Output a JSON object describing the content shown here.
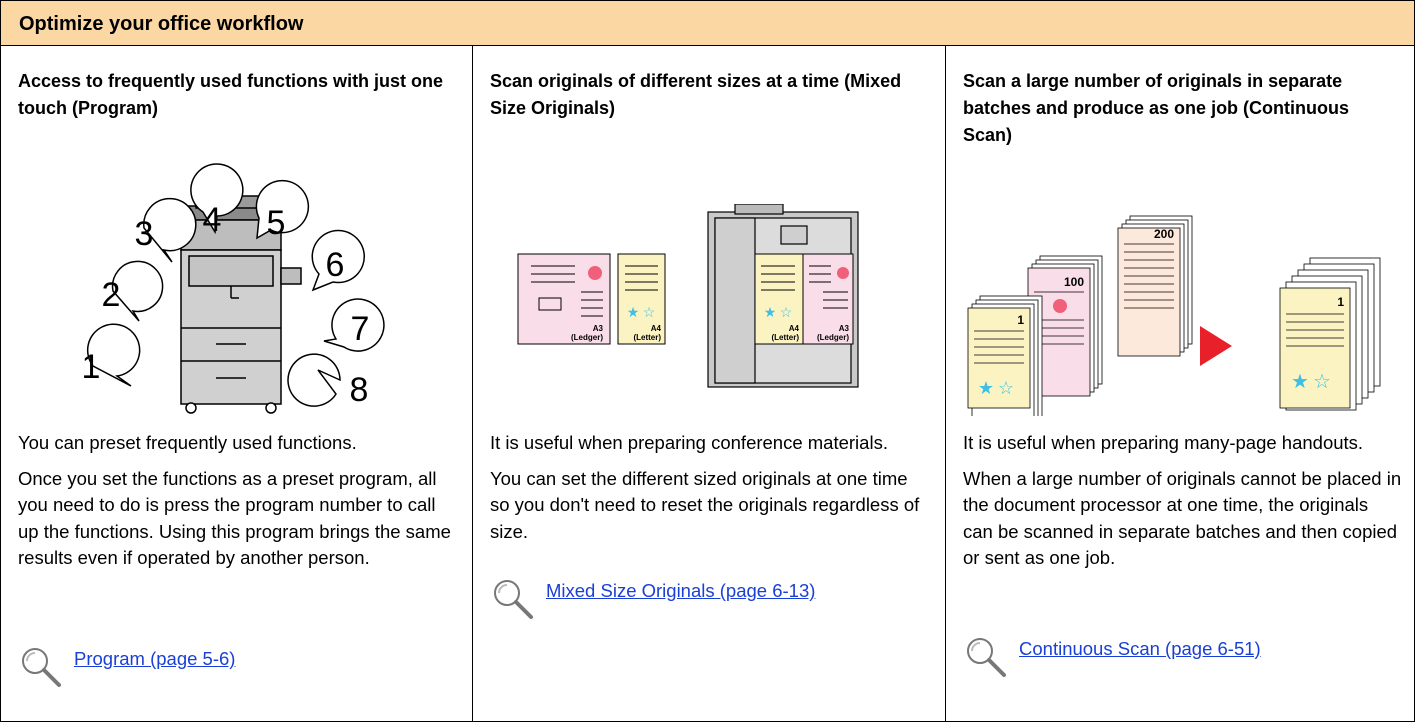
{
  "header": {
    "title": "Optimize your office workflow"
  },
  "columns": [
    {
      "heading": "Access to frequently used functions with just one touch (Program)",
      "paragraphs": [
        "You can preset frequently used functions.",
        "Once you set the functions as a preset program, all you need to do is press the program number to call up the functions. Using this program brings the same results even if operated by another person."
      ],
      "link": "Program (page 5-6)",
      "illustration": {
        "bubbles": [
          "1",
          "2",
          "3",
          "4",
          "5",
          "6",
          "7",
          "8"
        ]
      }
    },
    {
      "heading": "Scan originals of different sizes at a time (Mixed Size Originals)",
      "paragraphs": [
        "It is useful when preparing conference materials.",
        "You can set the different sized originals at one time so you don't need to reset the originals regardless of size."
      ],
      "link": "Mixed Size Originals (page 6-13)",
      "illustration": {
        "page_a3_size": "A3",
        "page_a3_name": "(Ledger)",
        "page_a4_size": "A4",
        "page_a4_name": "(Letter)"
      }
    },
    {
      "heading": "Scan a large number of originals in separate batches and produce as one job (Continuous Scan)",
      "paragraphs": [
        "It is useful when preparing many-page handouts.",
        "When a large number of originals cannot be placed in the document processor at one time, the originals can be scanned in separate batches and then copied or sent as one job."
      ],
      "link": "Continuous Scan (page 6-51)",
      "illustration": {
        "stack_labels": [
          "1",
          "100",
          "200"
        ],
        "result_label": "1"
      }
    }
  ],
  "colors": {
    "header_bg": "#fbd7a4",
    "link": "#1a3fd6",
    "pink_page": "#f9dde8",
    "yellow_page": "#fbf4c2",
    "star": "#3dbfe6"
  }
}
